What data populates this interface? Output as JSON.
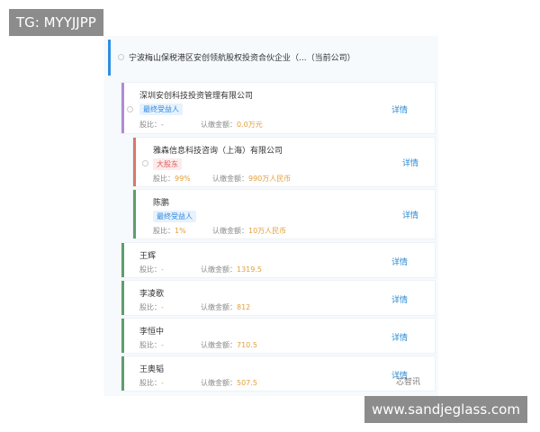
{
  "overlay": {
    "top_left": "TG: MYYJJPP",
    "bottom_right": "www.sandjeglass.com",
    "brand": "芯智讯"
  },
  "current": {
    "name": "宁波梅山保税港区安创领航股权投资合伙企业（...（当前公司）",
    "color": "#2e8fe0"
  },
  "labels": {
    "ratio": "股比：",
    "amount": "认缴金额：",
    "detail": "详情"
  },
  "level1_top": {
    "name": "深圳安创科技投资管理有限公司",
    "tag": "最终受益人",
    "ratio": "-",
    "amount": "0.0万元",
    "color": "#b48ad6"
  },
  "level2": [
    {
      "name": "雅森信息科技咨询（上海）有限公司",
      "tag": "大股东",
      "tag_type": "red",
      "ratio": "99%",
      "amount": "990万人民币",
      "color": "#d9776a"
    },
    {
      "name": "陈鹏",
      "tag": "最终受益人",
      "tag_type": "blue",
      "ratio": "1%",
      "amount": "10万人民币",
      "color": "#5f9e6e"
    }
  ],
  "level1": [
    {
      "name": "王辉",
      "ratio": "-",
      "amount": "1319.5",
      "color": "#5f9e6e"
    },
    {
      "name": "李凌歌",
      "ratio": "-",
      "amount": "812",
      "color": "#5f9e6e"
    },
    {
      "name": "李恒中",
      "ratio": "-",
      "amount": "710.5",
      "color": "#5f9e6e"
    },
    {
      "name": "王奥韬",
      "ratio": "-",
      "amount": "507.5",
      "color": "#5f9e6e"
    }
  ]
}
